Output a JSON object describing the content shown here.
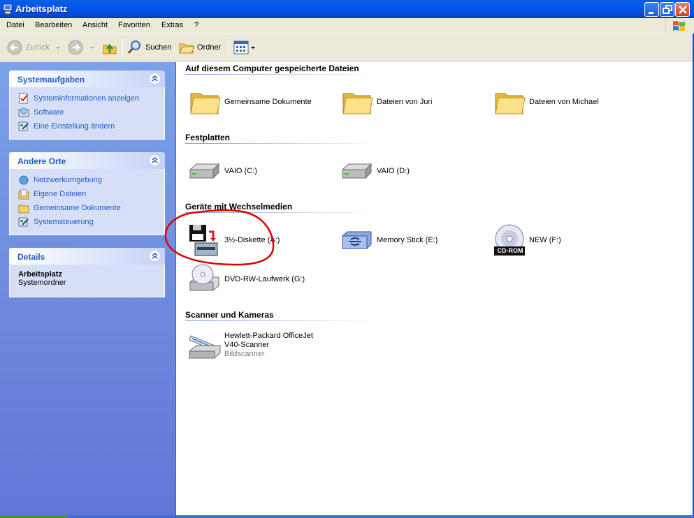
{
  "window": {
    "title": "Arbeitsplatz",
    "controls": {
      "minimize": "minimize",
      "maximize": "restore",
      "close": "close"
    }
  },
  "menu": {
    "items": [
      "Datei",
      "Bearbeiten",
      "Ansicht",
      "Favoriten",
      "Extras",
      "?"
    ]
  },
  "toolbar": {
    "back_label": "Zurück",
    "search_label": "Suchen",
    "folders_label": "Ordner"
  },
  "sidebar": {
    "system_tasks": {
      "title": "Systemaufgaben",
      "items": [
        "Systeminformationen anzeigen",
        "Software",
        "Eine Einstellung ändern"
      ]
    },
    "other_places": {
      "title": "Andere Orte",
      "items": [
        "Netzwerkumgebung",
        "Eigene Dateien",
        "Gemeinsame Dokumente",
        "Systemsteuerung"
      ]
    },
    "details": {
      "title": "Details",
      "name": "Arbeitsplatz",
      "type": "Systemordner"
    }
  },
  "groups": {
    "files": {
      "title": "Auf diesem Computer gespeicherte Dateien",
      "items": [
        "Gemeinsame Dokumente",
        "Dateien von Juri",
        "Dateien von Michael"
      ]
    },
    "disks": {
      "title": "Festplatten",
      "items": [
        "VAIO (C:)",
        "VAIO (D:)"
      ]
    },
    "removable": {
      "title": "Geräte mit Wechselmedien",
      "items": [
        "3½-Diskette (A:)",
        "Memory Stick (E:)",
        "NEW (F:)",
        "DVD-RW-Laufwerk (G:)"
      ],
      "cdrom_badge": "CD-ROM"
    },
    "scanners": {
      "title": "Scanner und Kameras",
      "item_name_line1": "Hewlett-Packard OfficeJet",
      "item_name_line2": "V40-Scanner",
      "item_type": "Bildscanner"
    }
  },
  "colors": {
    "titlebar": "#0058ee",
    "sidebar_link": "#215dc6",
    "annotation": "#e00000"
  }
}
